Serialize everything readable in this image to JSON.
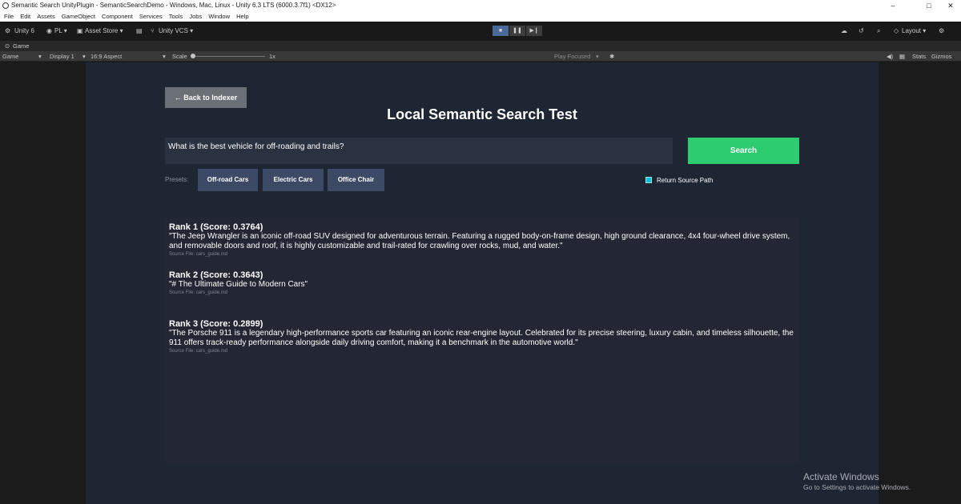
{
  "window": {
    "title": "Semantic Search UnityPlugin - SemanticSearchDemo - Windows, Mac, Linux - Unity 6.3 LTS (6000.3.7f1) <DX12>",
    "minimize": "–",
    "maximize": "□",
    "close": "✕"
  },
  "menu": [
    "File",
    "Edit",
    "Assets",
    "GameObject",
    "Component",
    "Services",
    "Tools",
    "Jobs",
    "Window",
    "Help"
  ],
  "toolbar": {
    "unity": "Unity 6",
    "account": "PL ▾",
    "asset_store": "Asset Store ▾",
    "vcs": "Unity VCS ▾",
    "layout": "Layout ▾"
  },
  "game_tab": "Game",
  "game_bar": {
    "view": "Game",
    "display": "Display 1",
    "aspect": "16:9 Aspect",
    "scale_label": "Scale",
    "scale_value": "1x",
    "play_focused": "Play Focused",
    "stats": "Stats",
    "gizmos": "Gizmos"
  },
  "app": {
    "back_button": "← Back to Indexer",
    "title": "Local Semantic Search Test",
    "query": "What is the best vehicle for off-roading and trails?",
    "search_button": "Search",
    "presets_label": "Presets:",
    "presets": [
      "Off-road Cars",
      "Electric Cars",
      "Office Chair"
    ],
    "return_source_path": "Return Source Path",
    "return_source_path_checked": true,
    "results": [
      {
        "rank": "Rank 1 (Score: 0.3764)",
        "text": "\"The Jeep Wrangler is an iconic off-road SUV designed for adventurous terrain. Featuring a rugged body-on-frame design, high ground clearance, 4x4 four-wheel drive system, and removable doors and roof, it is highly customizable and trail-rated for crawling over rocks, mud, and water.\"",
        "source": "Source File: cars_guide.md"
      },
      {
        "rank": "Rank 2 (Score: 0.3643)",
        "text": "\"# The Ultimate Guide to Modern Cars\"",
        "source": "Source File: cars_guide.md"
      },
      {
        "rank": "Rank 3 (Score: 0.2899)",
        "text": "\"The Porsche 911 is a legendary high-performance sports car featuring an iconic rear-engine layout. Celebrated for its precise steering, luxury cabin, and timeless silhouette, the 911 offers track-ready performance alongside daily driving comfort, making it a benchmark in the automotive world.\"",
        "source": "Source File: cars_guide.md"
      }
    ]
  },
  "watermark": {
    "line1": "Activate Windows",
    "line2": "Go to Settings to activate Windows."
  },
  "colors": {
    "search_button": "#2ecc71",
    "preset_button": "#3d4a66",
    "canvas_bg": "#1f2633",
    "checkbox": "#0ec0d0"
  }
}
